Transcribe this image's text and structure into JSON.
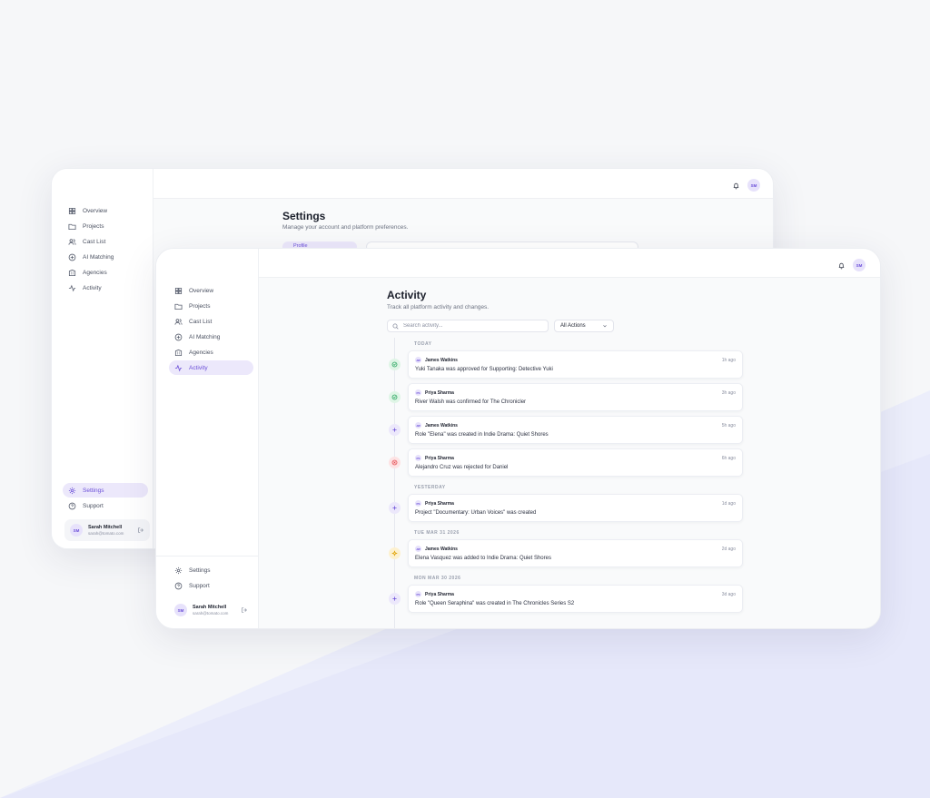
{
  "colors": {
    "accent": "#6b4fd8",
    "accent_soft": "#ece8fb",
    "success": "#22a35a",
    "danger": "#e5484d",
    "warning": "#e0a100"
  },
  "back_window": {
    "nav": [
      {
        "label": "Overview",
        "icon": "grid-icon"
      },
      {
        "label": "Projects",
        "icon": "folder-icon"
      },
      {
        "label": "Cast List",
        "icon": "users-icon"
      },
      {
        "label": "AI Matching",
        "icon": "sparkle-icon"
      },
      {
        "label": "Agencies",
        "icon": "building-icon"
      },
      {
        "label": "Activity",
        "icon": "activity-icon"
      }
    ],
    "nav_bottom": [
      {
        "label": "Settings",
        "icon": "gear-icon"
      },
      {
        "label": "Support",
        "icon": "help-icon"
      }
    ],
    "page_title": "Settings",
    "page_subtitle": "Manage your account and platform preferences.",
    "tab_label": "Profile",
    "user": {
      "initials": "SM",
      "name": "Sarah Mitchell",
      "email": "sarah@tomato.com"
    }
  },
  "front_window": {
    "nav": [
      {
        "label": "Overview",
        "icon": "grid-icon"
      },
      {
        "label": "Projects",
        "icon": "folder-icon"
      },
      {
        "label": "Cast List",
        "icon": "users-icon"
      },
      {
        "label": "AI Matching",
        "icon": "sparkle-icon"
      },
      {
        "label": "Agencies",
        "icon": "building-icon"
      },
      {
        "label": "Activity",
        "icon": "activity-icon"
      }
    ],
    "nav_bottom": [
      {
        "label": "Settings",
        "icon": "gear-icon"
      },
      {
        "label": "Support",
        "icon": "help-icon"
      }
    ],
    "user": {
      "initials": "SM",
      "name": "Sarah Mitchell",
      "email": "sarah@tomato.com"
    },
    "header_avatar": "SM"
  },
  "activity": {
    "title": "Activity",
    "subtitle": "Track all platform activity and changes.",
    "search_placeholder": "Search activity...",
    "filter_value": "All Actions",
    "groups": [
      {
        "label": "TODAY",
        "events": [
          {
            "type": "approved",
            "icon": "check-circle-icon",
            "actor_initials": "JW",
            "actor": "James Watkins",
            "text": "Yuki Tanaka was approved for Supporting: Detective Yuki",
            "time": "1h ago"
          },
          {
            "type": "approved",
            "icon": "check-circle-icon",
            "actor_initials": "PS",
            "actor": "Priya Sharma",
            "text": "River Walsh was confirmed for The Chronicler",
            "time": "3h ago"
          },
          {
            "type": "created",
            "icon": "plus-icon",
            "actor_initials": "JW",
            "actor": "James Watkins",
            "text": "Role \"Elena\" was created in Indie Drama: Quiet Shores",
            "time": "5h ago"
          },
          {
            "type": "rejected",
            "icon": "x-circle-icon",
            "actor_initials": "PS",
            "actor": "Priya Sharma",
            "text": "Alejandro Cruz was rejected for Daniel",
            "time": "6h ago"
          }
        ]
      },
      {
        "label": "YESTERDAY",
        "events": [
          {
            "type": "created",
            "icon": "plus-icon",
            "actor_initials": "PS",
            "actor": "Priya Sharma",
            "text": "Project \"Documentary: Urban Voices\" was created",
            "time": "1d ago"
          }
        ]
      },
      {
        "label": "TUE MAR 31 2026",
        "events": [
          {
            "type": "added",
            "icon": "star-icon",
            "actor_initials": "JW",
            "actor": "James Watkins",
            "text": "Elena Vasquez was added to Indie Drama: Quiet Shores",
            "time": "2d ago"
          }
        ]
      },
      {
        "label": "MON MAR 30 2026",
        "events": [
          {
            "type": "created",
            "icon": "plus-icon",
            "actor_initials": "PS",
            "actor": "Priya Sharma",
            "text": "Role \"Queen Seraphina\" was created in The Chronicles Series S2",
            "time": "3d ago"
          }
        ]
      }
    ]
  }
}
